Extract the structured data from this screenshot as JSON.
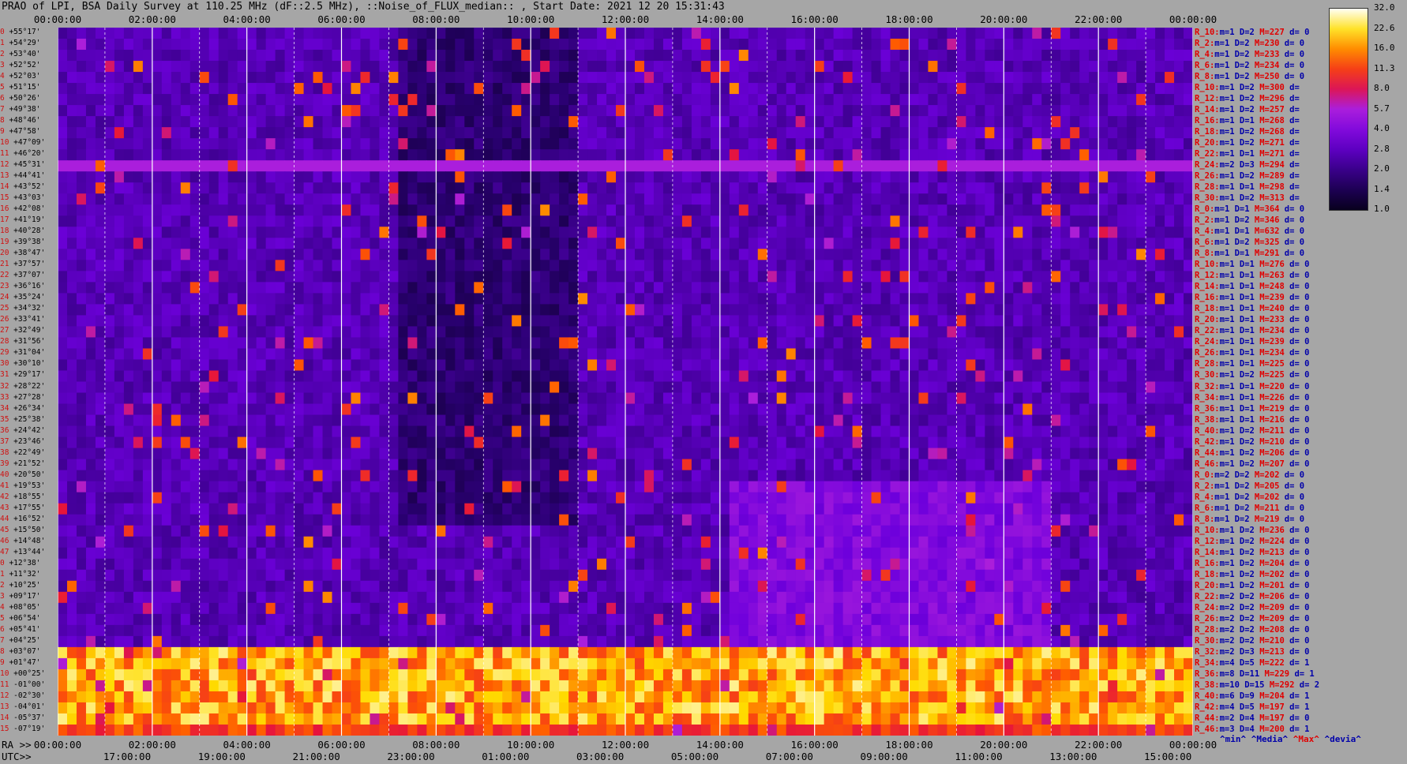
{
  "title": "PRAO of LPI, BSA Daily Survey at 110.25 MHz (dF::2.5 MHz), ::Noise_of_FLUX_median:: , Start Date: 2021 12 20 15:31:43",
  "chart_data": {
    "type": "heatmap",
    "title": "PRAO of LPI, BSA Daily Survey at 110.25 MHz (dF::2.5 MHz), ::Noise_of_FLUX_median:: , Start Date: 2021 12 20 15:31:43",
    "x_ticks_top": [
      "00:00:00",
      "02:00:00",
      "04:00:00",
      "06:00:00",
      "08:00:00",
      "10:00:00",
      "12:00:00",
      "14:00:00",
      "16:00:00",
      "18:00:00",
      "20:00:00",
      "22:00:00",
      "00:00:00"
    ],
    "ra_label": "RA >>",
    "ra_ticks": [
      "00:00:00",
      "02:00:00",
      "04:00:00",
      "06:00:00",
      "08:00:00",
      "10:00:00",
      "12:00:00",
      "14:00:00",
      "16:00:00",
      "18:00:00",
      "20:00:00",
      "22:00:00",
      "00:00:00"
    ],
    "utc_label": "UTC>>",
    "utc_ticks": [
      "17:00:00",
      "19:00:00",
      "21:00:00",
      "23:00:00",
      "01:00:00",
      "03:00:00",
      "05:00:00",
      "07:00:00",
      "09:00:00",
      "11:00:00",
      "13:00:00",
      "15:00:00"
    ],
    "dec_labels": [
      "+55°17'",
      "+54°29'",
      "+53°40'",
      "+52°52'",
      "+52°03'",
      "+51°15'",
      "+50°26'",
      "+49°38'",
      "+48°46'",
      "+47°58'",
      "+47°09'",
      "+46°20'",
      "+45°31'",
      "+44°41'",
      "+43°52'",
      "+43°03'",
      "+42°08'",
      "+41°19'",
      "+40°28'",
      "+39°38'",
      "+38°47'",
      "+37°57'",
      "+37°07'",
      "+36°16'",
      "+35°24'",
      "+34°32'",
      "+33°41'",
      "+32°49'",
      "+31°56'",
      "+31°04'",
      "+30°10'",
      "+29°17'",
      "+28°22'",
      "+27°28'",
      "+26°34'",
      "+25°38'",
      "+24°42'",
      "+23°46'",
      "+22°49'",
      "+21°52'",
      "+20°50'",
      "+19°53'",
      "+18°55'",
      "+17°55'",
      "+16°52'",
      "+15°50'",
      "+14°48'",
      "+13°44'",
      "+12°38'",
      "+11°32'",
      "+10°25'",
      "+09°17'",
      "+08°05'",
      "+06°54'",
      "+05°41'",
      "+04°25'",
      "+03°07'",
      "+01°47'",
      "+00°25'",
      "-01°00'",
      "-02°30'",
      "-04°01'",
      "-05°37'",
      "-07°19'"
    ],
    "colorbar": {
      "ticks": [
        "32.0",
        "22.6",
        "16.0",
        "11.3",
        "8.0",
        "5.7",
        "4.0",
        "2.8",
        "2.0",
        "1.4",
        "1.0"
      ],
      "min": 1.0,
      "max": 32.0,
      "scale": "log"
    },
    "stats": [
      {
        "r": "R_10:",
        "m": "m=1",
        "d": "D=2",
        "M": "M=227",
        "dv": "d= 0"
      },
      {
        "r": "R_2:",
        "m": "m=1",
        "d": "D=2",
        "M": "M=230",
        "dv": "d= 0"
      },
      {
        "r": "R_4:",
        "m": "m=1",
        "d": "D=2",
        "M": "M=233",
        "dv": "d= 0"
      },
      {
        "r": "R_6:",
        "m": "m=1",
        "d": "D=2",
        "M": "M=234",
        "dv": "d= 0"
      },
      {
        "r": "R_8:",
        "m": "m=1",
        "d": "D=2",
        "M": "M=250",
        "dv": "d= 0"
      },
      {
        "r": "R_10:",
        "m": "m=1",
        "d": "D=2",
        "M": "M=300",
        "dv": "d="
      },
      {
        "r": "R_12:",
        "m": "m=1",
        "d": "D=2",
        "M": "M=296",
        "dv": "d="
      },
      {
        "r": "R_14:",
        "m": "m=1",
        "d": "D=2",
        "M": "M=257",
        "dv": "d="
      },
      {
        "r": "R_16:",
        "m": "m=1",
        "d": "D=1",
        "M": "M=268",
        "dv": "d="
      },
      {
        "r": "R_18:",
        "m": "m=1",
        "d": "D=2",
        "M": "M=268",
        "dv": "d="
      },
      {
        "r": "R_20:",
        "m": "m=1",
        "d": "D=2",
        "M": "M=271",
        "dv": "d="
      },
      {
        "r": "R_22:",
        "m": "m=1",
        "d": "D=1",
        "M": "M=271",
        "dv": "d="
      },
      {
        "r": "R_24:",
        "m": "m=2",
        "d": "D=3",
        "M": "M=294",
        "dv": "d="
      },
      {
        "r": "R_26:",
        "m": "m=1",
        "d": "D=2",
        "M": "M=289",
        "dv": "d="
      },
      {
        "r": "R_28:",
        "m": "m=1",
        "d": "D=1",
        "M": "M=298",
        "dv": "d="
      },
      {
        "r": "R_30:",
        "m": "m=1",
        "d": "D=2",
        "M": "M=313",
        "dv": "d="
      },
      {
        "r": "R_0:",
        "m": "m=1",
        "d": "D=1",
        "M": "M=364",
        "dv": "d= 0"
      },
      {
        "r": "R_2:",
        "m": "m=1",
        "d": "D=2",
        "M": "M=346",
        "dv": "d= 0"
      },
      {
        "r": "R_4:",
        "m": "m=1",
        "d": "D=1",
        "M": "M=632",
        "dv": "d= 0"
      },
      {
        "r": "R_6:",
        "m": "m=1",
        "d": "D=2",
        "M": "M=325",
        "dv": "d= 0"
      },
      {
        "r": "R_8:",
        "m": "m=1",
        "d": "D=1",
        "M": "M=291",
        "dv": "d= 0"
      },
      {
        "r": "R_10:",
        "m": "m=1",
        "d": "D=1",
        "M": "M=276",
        "dv": "d= 0"
      },
      {
        "r": "R_12:",
        "m": "m=1",
        "d": "D=1",
        "M": "M=263",
        "dv": "d= 0"
      },
      {
        "r": "R_14:",
        "m": "m=1",
        "d": "D=1",
        "M": "M=248",
        "dv": "d= 0"
      },
      {
        "r": "R_16:",
        "m": "m=1",
        "d": "D=1",
        "M": "M=239",
        "dv": "d= 0"
      },
      {
        "r": "R_18:",
        "m": "m=1",
        "d": "D=1",
        "M": "M=240",
        "dv": "d= 0"
      },
      {
        "r": "R_20:",
        "m": "m=1",
        "d": "D=1",
        "M": "M=233",
        "dv": "d= 0"
      },
      {
        "r": "R_22:",
        "m": "m=1",
        "d": "D=1",
        "M": "M=234",
        "dv": "d= 0"
      },
      {
        "r": "R_24:",
        "m": "m=1",
        "d": "D=1",
        "M": "M=239",
        "dv": "d= 0"
      },
      {
        "r": "R_26:",
        "m": "m=1",
        "d": "D=1",
        "M": "M=234",
        "dv": "d= 0"
      },
      {
        "r": "R_28:",
        "m": "m=1",
        "d": "D=1",
        "M": "M=225",
        "dv": "d= 0"
      },
      {
        "r": "R_30:",
        "m": "m=1",
        "d": "D=2",
        "M": "M=225",
        "dv": "d= 0"
      },
      {
        "r": "R_32:",
        "m": "m=1",
        "d": "D=1",
        "M": "M=220",
        "dv": "d= 0"
      },
      {
        "r": "R_34:",
        "m": "m=1",
        "d": "D=1",
        "M": "M=226",
        "dv": "d= 0"
      },
      {
        "r": "R_36:",
        "m": "m=1",
        "d": "D=1",
        "M": "M=219",
        "dv": "d= 0"
      },
      {
        "r": "R_38:",
        "m": "m=1",
        "d": "D=1",
        "M": "M=216",
        "dv": "d= 0"
      },
      {
        "r": "R_40:",
        "m": "m=1",
        "d": "D=2",
        "M": "M=211",
        "dv": "d= 0"
      },
      {
        "r": "R_42:",
        "m": "m=1",
        "d": "D=2",
        "M": "M=210",
        "dv": "d= 0"
      },
      {
        "r": "R_44:",
        "m": "m=1",
        "d": "D=2",
        "M": "M=206",
        "dv": "d= 0"
      },
      {
        "r": "R_46:",
        "m": "m=1",
        "d": "D=2",
        "M": "M=207",
        "dv": "d= 0"
      },
      {
        "r": "R_0:",
        "m": "m=2",
        "d": "D=2",
        "M": "M=202",
        "dv": "d= 0"
      },
      {
        "r": "R_2:",
        "m": "m=1",
        "d": "D=2",
        "M": "M=205",
        "dv": "d= 0"
      },
      {
        "r": "R_4:",
        "m": "m=1",
        "d": "D=2",
        "M": "M=202",
        "dv": "d= 0"
      },
      {
        "r": "R_6:",
        "m": "m=1",
        "d": "D=2",
        "M": "M=211",
        "dv": "d= 0"
      },
      {
        "r": "R_8:",
        "m": "m=1",
        "d": "D=2",
        "M": "M=219",
        "dv": "d= 0"
      },
      {
        "r": "R_10:",
        "m": "m=1",
        "d": "D=2",
        "M": "M=236",
        "dv": "d= 0"
      },
      {
        "r": "R_12:",
        "m": "m=1",
        "d": "D=2",
        "M": "M=224",
        "dv": "d= 0"
      },
      {
        "r": "R_14:",
        "m": "m=1",
        "d": "D=2",
        "M": "M=213",
        "dv": "d= 0"
      },
      {
        "r": "R_16:",
        "m": "m=1",
        "d": "D=2",
        "M": "M=204",
        "dv": "d= 0"
      },
      {
        "r": "R_18:",
        "m": "m=1",
        "d": "D=2",
        "M": "M=202",
        "dv": "d= 0"
      },
      {
        "r": "R_20:",
        "m": "m=1",
        "d": "D=2",
        "M": "M=201",
        "dv": "d= 0"
      },
      {
        "r": "R_22:",
        "m": "m=2",
        "d": "D=2",
        "M": "M=206",
        "dv": "d= 0"
      },
      {
        "r": "R_24:",
        "m": "m=2",
        "d": "D=2",
        "M": "M=209",
        "dv": "d= 0"
      },
      {
        "r": "R_26:",
        "m": "m=2",
        "d": "D=2",
        "M": "M=209",
        "dv": "d= 0"
      },
      {
        "r": "R_28:",
        "m": "m=2",
        "d": "D=2",
        "M": "M=208",
        "dv": "d= 0"
      },
      {
        "r": "R_30:",
        "m": "m=2",
        "d": "D=2",
        "M": "M=210",
        "dv": "d= 0"
      },
      {
        "r": "R_32:",
        "m": "m=2",
        "d": "D=3",
        "M": "M=213",
        "dv": "d= 0"
      },
      {
        "r": "R_34:",
        "m": "m=4",
        "d": "D=5",
        "M": "M=222",
        "dv": "d= 1"
      },
      {
        "r": "R_36:",
        "m": "m=8",
        "d": "D=11",
        "M": "M=229",
        "dv": "d= 1"
      },
      {
        "r": "R_38:",
        "m": "m=10",
        "d": "D=15",
        "M": "M=292",
        "dv": "d= 2"
      },
      {
        "r": "R_40:",
        "m": "m=6",
        "d": "D=9",
        "M": "M=204",
        "dv": "d= 1"
      },
      {
        "r": "R_42:",
        "m": "m=4",
        "d": "D=5",
        "M": "M=197",
        "dv": "d= 1"
      },
      {
        "r": "R_44:",
        "m": "m=2",
        "d": "D=4",
        "M": "M=197",
        "dv": "d= 0"
      },
      {
        "r": "R_46:",
        "m": "m=3",
        "d": "D=4",
        "M": "M=200",
        "dv": "d= 1"
      }
    ],
    "legend": {
      "min": "^min^",
      "median": "^Media^",
      "max": "^Max^",
      "devia": "^devia^"
    }
  }
}
